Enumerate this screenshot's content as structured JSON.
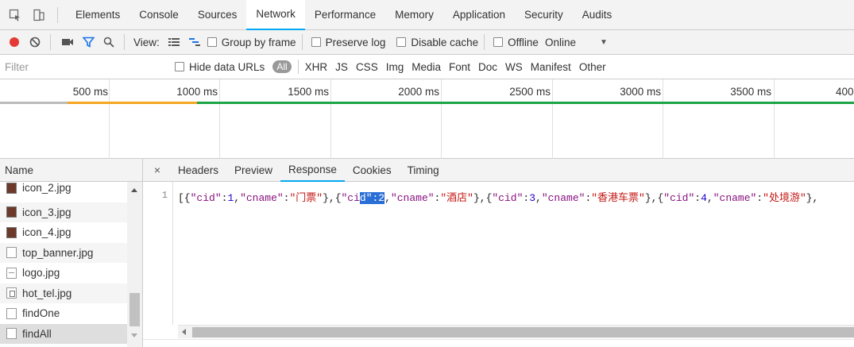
{
  "tabs": [
    {
      "label": "Elements"
    },
    {
      "label": "Console"
    },
    {
      "label": "Sources"
    },
    {
      "label": "Network",
      "active": true
    },
    {
      "label": "Performance"
    },
    {
      "label": "Memory"
    },
    {
      "label": "Application"
    },
    {
      "label": "Security"
    },
    {
      "label": "Audits"
    }
  ],
  "toolbar": {
    "view_label": "View:",
    "group_by_frame": "Group by frame",
    "preserve_log": "Preserve log",
    "disable_cache": "Disable cache",
    "offline": "Offline",
    "throttle": "Online",
    "record_color": "#e53935",
    "filter_icon_color": "#1a73e8"
  },
  "filter": {
    "placeholder": "Filter",
    "hide_data_urls": "Hide data URLs",
    "types": [
      "All",
      "XHR",
      "JS",
      "CSS",
      "Img",
      "Media",
      "Font",
      "Doc",
      "WS",
      "Manifest",
      "Other"
    ]
  },
  "timeline": {
    "ticks": [
      "500 ms",
      "1000 ms",
      "1500 ms",
      "2000 ms",
      "2500 ms",
      "3000 ms",
      "3500 ms",
      "400"
    ]
  },
  "requests": {
    "header": "Name",
    "items": [
      {
        "name": "icon_2.jpg",
        "type": "img"
      },
      {
        "name": "icon_3.jpg",
        "type": "img"
      },
      {
        "name": "icon_4.jpg",
        "type": "img"
      },
      {
        "name": "top_banner.jpg",
        "type": "blank"
      },
      {
        "name": "logo.jpg",
        "type": "doc"
      },
      {
        "name": "hot_tel.jpg",
        "type": "pic"
      },
      {
        "name": "findOne",
        "type": "blank"
      },
      {
        "name": "findAll",
        "type": "blank",
        "selected": true
      }
    ]
  },
  "detail": {
    "close": "×",
    "tabs": [
      {
        "label": "Headers"
      },
      {
        "label": "Preview"
      },
      {
        "label": "Response",
        "active": true
      },
      {
        "label": "Cookies"
      },
      {
        "label": "Timing"
      }
    ],
    "line_number": "1",
    "response": {
      "p1": "[{",
      "k1": "\"cid\"",
      "c1": ":",
      "n1": "1",
      "c2": ",",
      "k2": "\"cname\"",
      "c3": ":",
      "s1": "\"门票\"",
      "p2": "},{",
      "k3a": "\"ci",
      "hl": "d\":2",
      "c4": ",",
      "k4": "\"cname\"",
      "c5": ":",
      "s2": "\"酒店\"",
      "p3": "},{",
      "k5": "\"cid\"",
      "c6": ":",
      "n3": "3",
      "c7": ",",
      "k6": "\"cname\"",
      "c8": ":",
      "s3": "\"香港车票\"",
      "p4": "},{",
      "k7": "\"cid\"",
      "c9": ":",
      "n4": "4",
      "c10": ",",
      "k8": "\"cname\"",
      "c11": ":",
      "s4": "\"处境游\"",
      "p5": "},"
    }
  }
}
